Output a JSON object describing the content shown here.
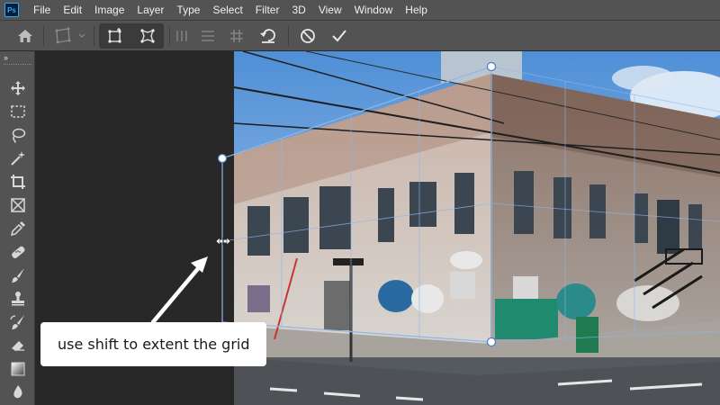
{
  "app": {
    "logo_text": "Ps"
  },
  "menu": [
    "File",
    "Edit",
    "Image",
    "Layer",
    "Type",
    "Select",
    "Filter",
    "3D",
    "View",
    "Window",
    "Help"
  ],
  "options_bar": {
    "buttons": [
      {
        "name": "home-icon"
      },
      {
        "name": "perspective-warp-dropdown-icon"
      },
      {
        "name": "layout-mode-icon"
      },
      {
        "name": "warp-mode-icon"
      },
      {
        "name": "auto-straighten-vertical-icon"
      },
      {
        "name": "auto-level-horizontal-icon"
      },
      {
        "name": "auto-straighten-both-icon"
      },
      {
        "name": "reset-icon"
      },
      {
        "name": "cancel-icon"
      },
      {
        "name": "commit-icon"
      }
    ]
  },
  "tools": [
    "move-tool-icon",
    "marquee-tool-icon",
    "lasso-tool-icon",
    "magic-wand-tool-icon",
    "crop-tool-icon",
    "frame-tool-icon",
    "eyedropper-tool-icon",
    "healing-brush-tool-icon",
    "brush-tool-icon",
    "clone-stamp-tool-icon",
    "history-brush-tool-icon",
    "eraser-tool-icon",
    "gradient-tool-icon",
    "blur-tool-icon"
  ],
  "tooltip": {
    "text": "use shift to extent the grid"
  },
  "colors": {
    "ui_bg": "#535353",
    "canvas_bg": "#282828",
    "accent": "#8fb6e8",
    "arrow": "#ffffff"
  }
}
